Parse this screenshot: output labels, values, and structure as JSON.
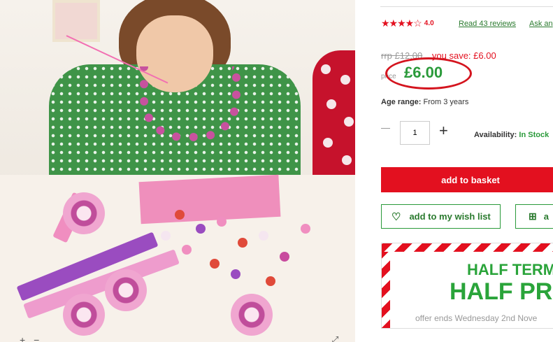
{
  "product": {
    "rating_stars": "★★★★☆",
    "rating_value": "4.0",
    "reviews_link": "Read 43 reviews",
    "ask_link": "Ask an",
    "rrp_label": "rrp £12.00",
    "you_save": "you save: £6.00",
    "price_label": "price",
    "price": "£6.00",
    "age_label": "Age range:",
    "age_value": "From 3 years",
    "quantity": "1",
    "availability_label": "Availability:",
    "availability_value": "In Stock"
  },
  "actions": {
    "add_to_basket": "add to basket",
    "wish_list": "add to my wish list",
    "gift_partial": "a"
  },
  "banner": {
    "line1": "HALF TERM",
    "line2": "HALF PRI",
    "offer": "offer ends Wednesday 2nd Nove"
  },
  "colors": {
    "brand_red": "#e3101f",
    "brand_green": "#2a9a3a"
  }
}
